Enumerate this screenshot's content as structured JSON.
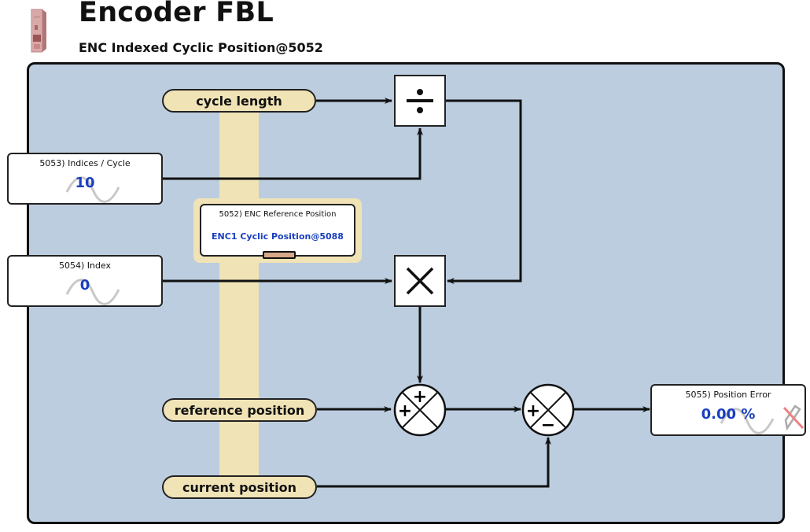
{
  "header": {
    "device_icon": "drive-module-icon",
    "title": "Encoder FBL",
    "subtitle": "ENC Indexed Cyclic Position@5052"
  },
  "inputs": {
    "cycle_length": "cycle length",
    "reference_position": "reference position",
    "current_position": "current position"
  },
  "params": {
    "indices_per_cycle": {
      "label": "5053) Indices / Cycle",
      "value": "10"
    },
    "index": {
      "label": "5054) Index",
      "value": "0"
    },
    "reference": {
      "label": "5052) ENC Reference Position",
      "value": "ENC1 Cyclic Position@5088"
    },
    "position_error": {
      "label": "5055) Position Error",
      "value": "0.00 %"
    }
  },
  "operators": {
    "divide": "divide-icon",
    "multiply": "multiply-icon",
    "sum1": {
      "signs": [
        "+",
        "+"
      ]
    },
    "sum2": {
      "signs": [
        "+",
        "−"
      ]
    }
  },
  "colors": {
    "panel": "#bccddf",
    "bus": "#f0e3b6",
    "value_text": "#1a3fbf"
  }
}
